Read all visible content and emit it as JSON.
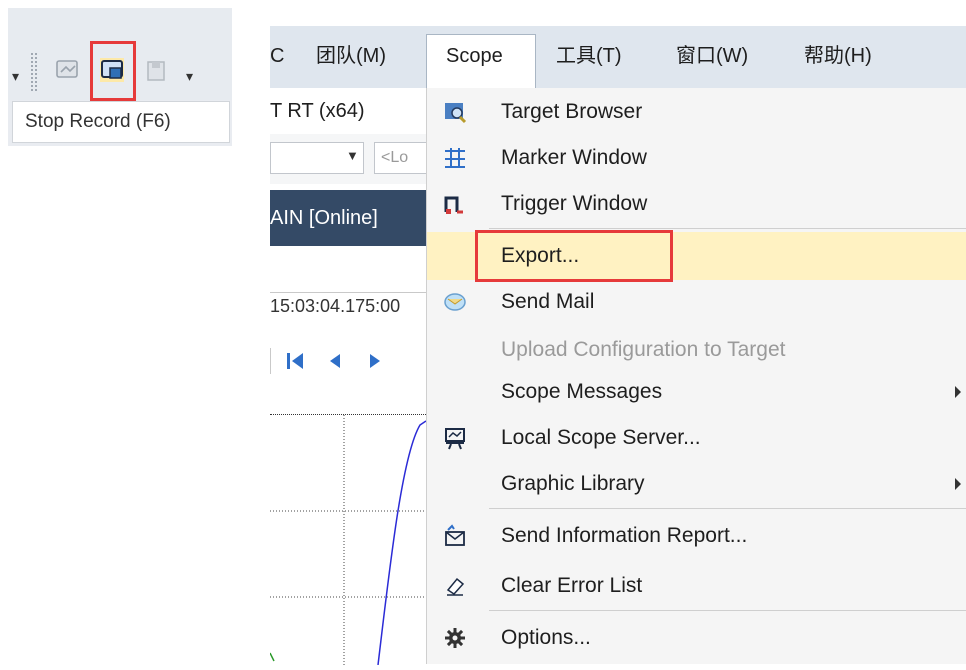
{
  "left_toolbar": {
    "tooltip": "Stop Record (F6)",
    "icons": [
      "start-record-icon",
      "stop-record-icon",
      "save-icon"
    ],
    "highlight_color": "#e63a3a"
  },
  "menubar": {
    "items": [
      "C",
      "团队(M)",
      "Scope",
      "工具(T)",
      "窗口(W)",
      "帮助(H)"
    ]
  },
  "workspace": {
    "platform": "T RT (x64)",
    "location_placeholder": "<Lo",
    "doc_tab": "AIN [Online]",
    "timestamp": "15:03:04.175:00"
  },
  "scope_menu": {
    "items": [
      {
        "label": "Target Browser",
        "icon": "target-browser-icon",
        "enabled": true
      },
      {
        "label": "Marker Window",
        "icon": "marker-window-icon",
        "enabled": true
      },
      {
        "label": "Trigger Window",
        "icon": "trigger-window-icon",
        "enabled": true
      },
      {
        "label": "Export...",
        "icon": "",
        "enabled": true,
        "highlighted": true
      },
      {
        "label": "Send Mail",
        "icon": "send-mail-icon",
        "enabled": true
      },
      {
        "label": "Upload Configuration to Target",
        "icon": "",
        "enabled": false
      },
      {
        "label": "Scope Messages",
        "icon": "",
        "enabled": true,
        "submenu": true
      },
      {
        "label": "Local Scope Server...",
        "icon": "local-scope-server-icon",
        "enabled": true
      },
      {
        "label": "Graphic Library",
        "icon": "",
        "enabled": true,
        "submenu": true
      },
      {
        "label": "Send Information Report...",
        "icon": "send-report-icon",
        "enabled": true
      },
      {
        "label": "Clear Error List",
        "icon": "eraser-icon",
        "enabled": true
      },
      {
        "label": "Options...",
        "icon": "gear-icon",
        "enabled": true
      }
    ]
  },
  "colors": {
    "menubar_bg": "#dfe6ee",
    "doc_tab_bg": "#344a66",
    "highlight_bg": "#fff2c2",
    "annotation_red": "#e63a3a",
    "plot_line": "#2b2bd6"
  }
}
